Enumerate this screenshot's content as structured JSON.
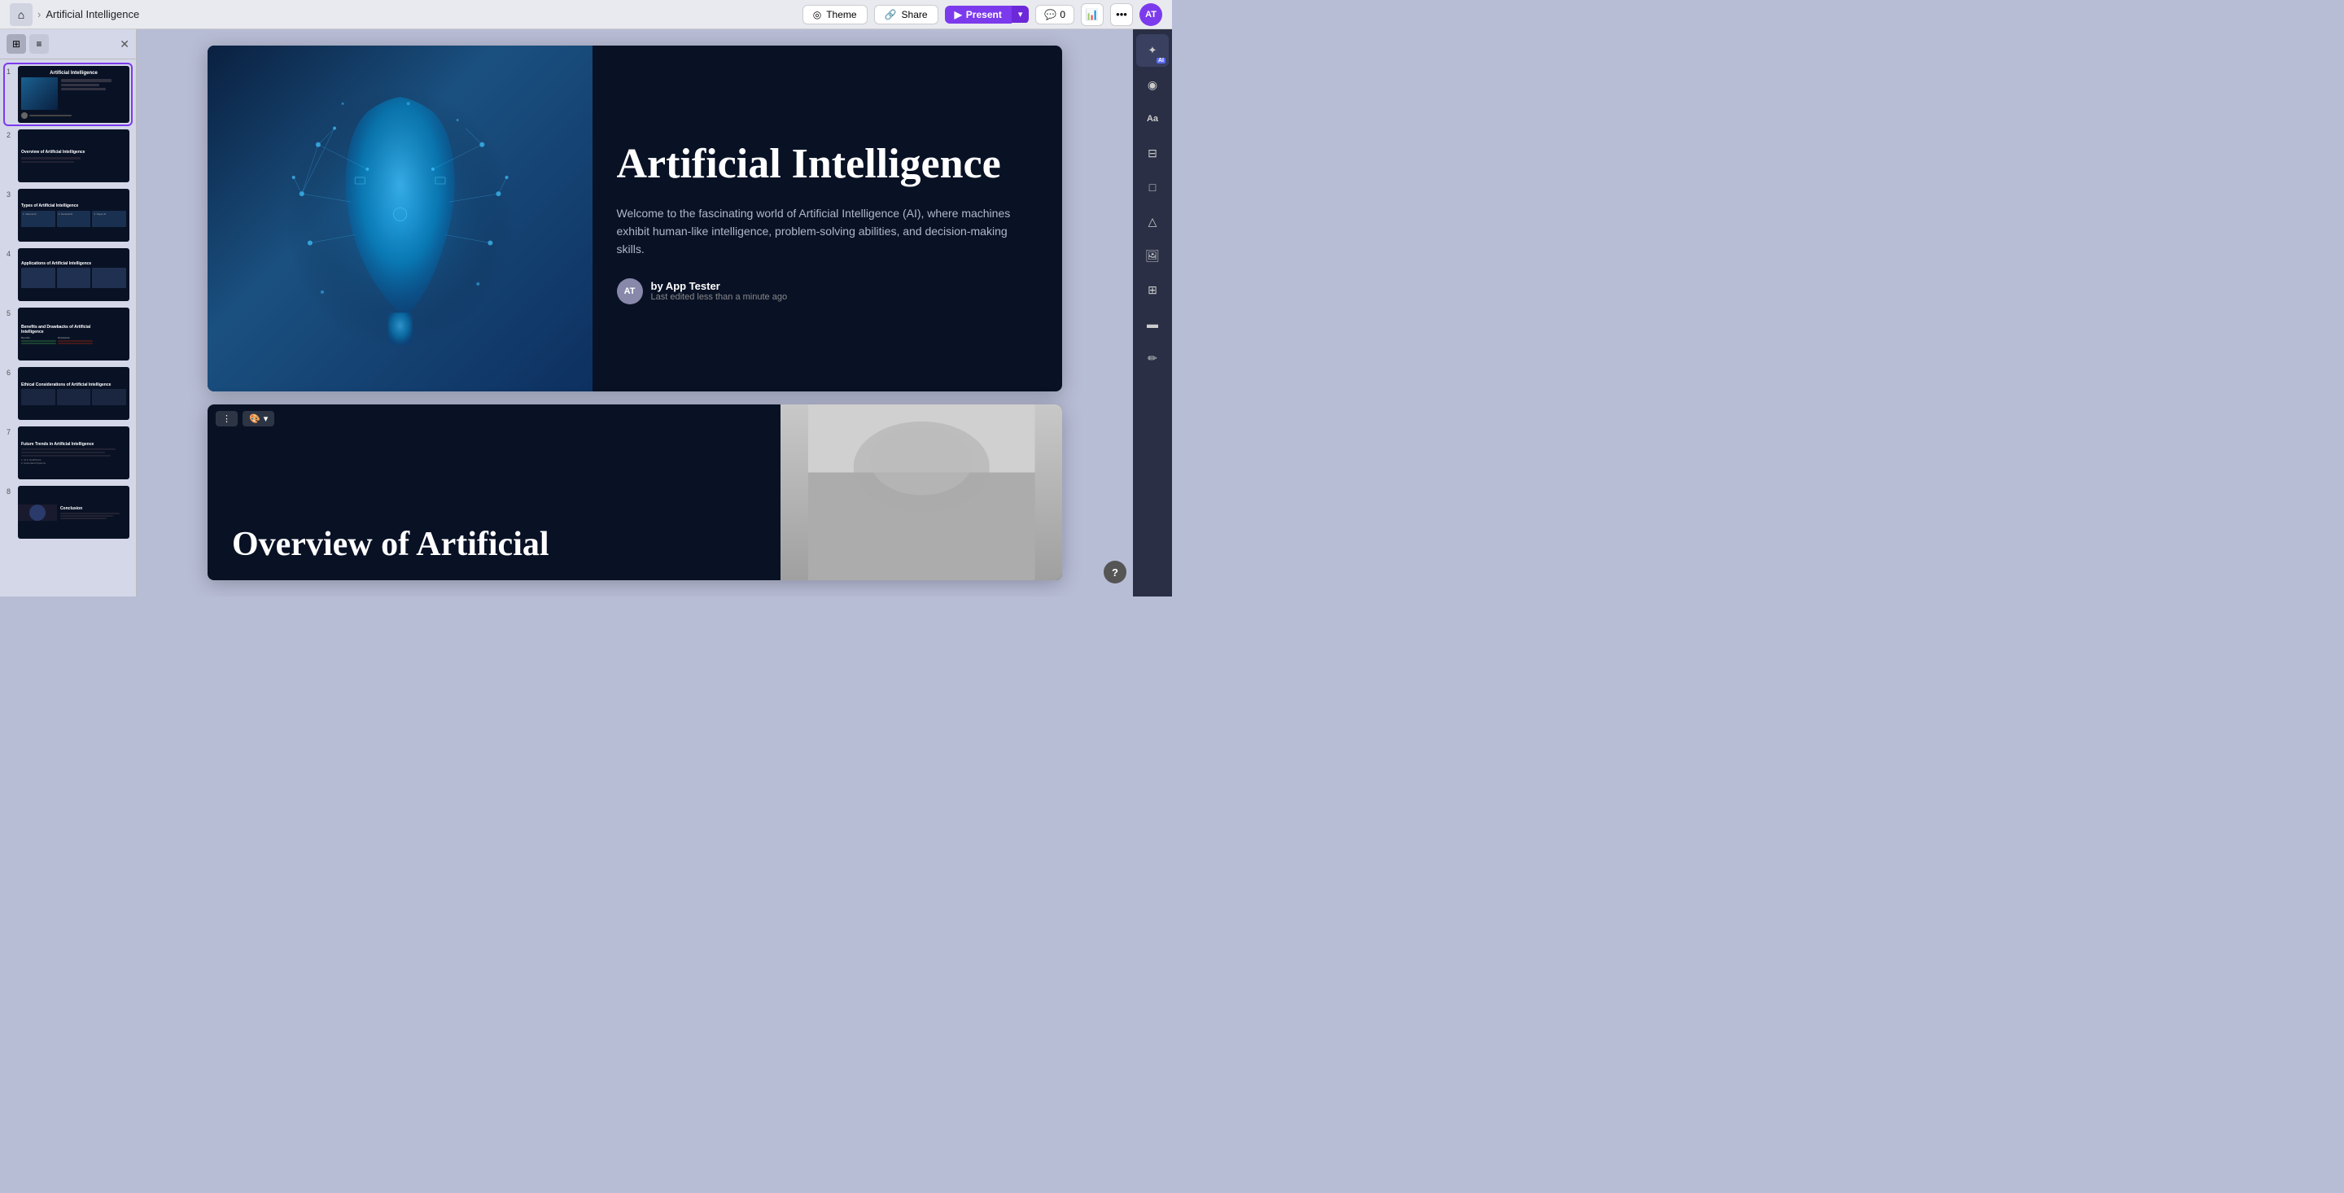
{
  "topbar": {
    "home_icon": "🏠",
    "breadcrumb_sep": "›",
    "breadcrumb_title": "Artificial Intelligence",
    "theme_label": "Theme",
    "theme_icon": "◎",
    "share_label": "Share",
    "share_icon": "🔗",
    "present_label": "Present",
    "present_icon": "▶",
    "present_dropdown_icon": "▾",
    "comments_icon": "💬",
    "comments_count": "0",
    "analytics_icon": "📊",
    "more_icon": "•••",
    "avatar_initials": "AT"
  },
  "sidebar": {
    "close_icon": "✕",
    "grid_view_icon": "⊞",
    "list_view_icon": "≡",
    "slides": [
      {
        "number": "1",
        "title": "Artificial Intelligence",
        "type": "cover"
      },
      {
        "number": "2",
        "title": "Overview of Artificial Intelligence",
        "type": "overview"
      },
      {
        "number": "3",
        "title": "Types of Artificial Intelligence",
        "type": "types"
      },
      {
        "number": "4",
        "title": "Applications of Artificial Intelligence",
        "type": "applications"
      },
      {
        "number": "5",
        "title": "Benefits and Drawbacks of Artificial Intelligence",
        "type": "benefits"
      },
      {
        "number": "6",
        "title": "Ethical Considerations of Artificial Intelligence",
        "type": "ethical"
      },
      {
        "number": "7",
        "title": "Future Trends in Artificial Intelligence",
        "type": "future"
      },
      {
        "number": "8",
        "title": "Conclusion",
        "type": "conclusion"
      }
    ]
  },
  "slide1": {
    "title": "Artificial Intelligence",
    "subtitle": "Welcome to the fascinating world of Artificial Intelligence (AI), where machines exhibit human-like intelligence, problem-solving abilities, and decision-making skills.",
    "author_initials": "AT",
    "author_name": "by App Tester",
    "author_time": "Last edited less than a minute ago"
  },
  "slide2": {
    "title": "Overview of Artificial",
    "toolbar_dots": "⋮",
    "toolbar_palette": "🎨",
    "toolbar_dropdown": "▾"
  },
  "right_toolbar": {
    "tools": [
      {
        "icon": "✦",
        "badge": "AI",
        "name": "ai-tool"
      },
      {
        "icon": "◉",
        "name": "style-tool"
      },
      {
        "icon": "Aa",
        "name": "text-tool"
      },
      {
        "icon": "⊟",
        "name": "layout-tool"
      },
      {
        "icon": "□",
        "name": "shape-tool"
      },
      {
        "icon": "▲",
        "name": "triangle-tool"
      },
      {
        "icon": "🖼",
        "name": "image-tool"
      },
      {
        "icon": "⊞",
        "name": "grid-tool"
      },
      {
        "icon": "▬",
        "name": "bar-tool"
      },
      {
        "icon": "✏",
        "name": "edit-tool"
      }
    ]
  },
  "help": {
    "label": "?"
  }
}
